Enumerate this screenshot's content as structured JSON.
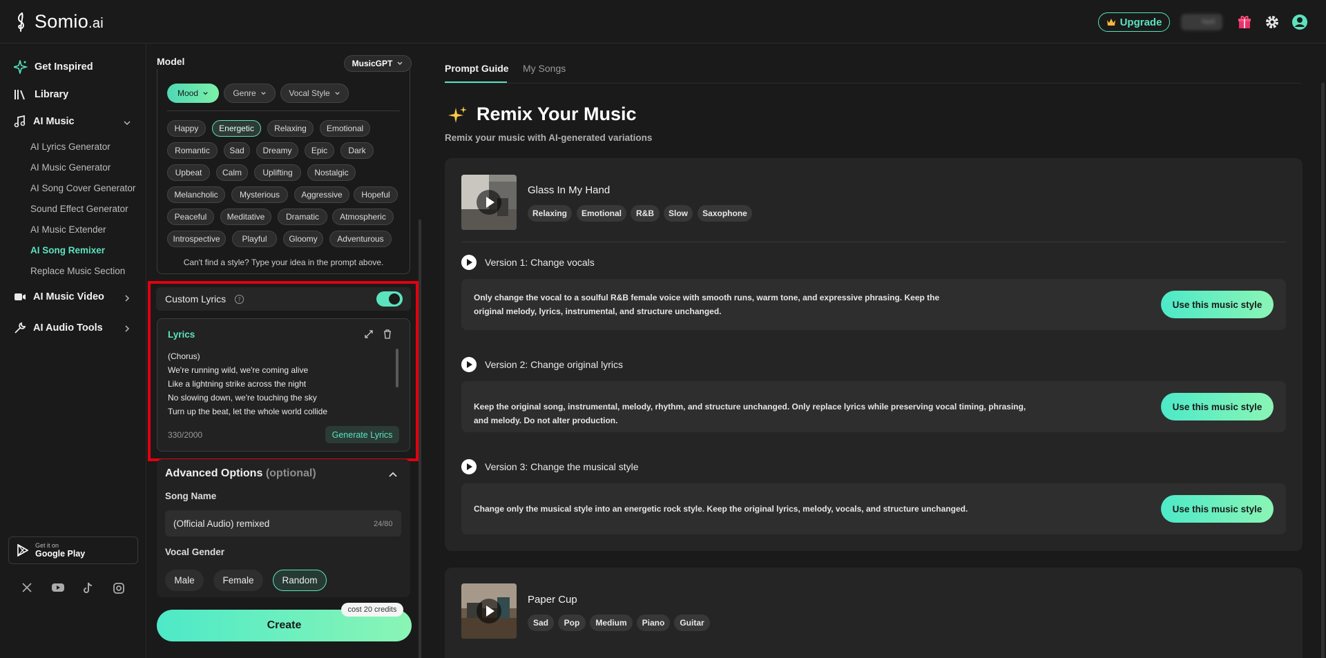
{
  "app": {
    "logo_text": "Somio",
    "logo_suffix": ".ai"
  },
  "header": {
    "upgrade_label": "Upgrade",
    "user_name": "Neil"
  },
  "sidebar": {
    "top_items": [
      {
        "label": "Get Inspired",
        "icon": "sparkle-icon"
      },
      {
        "label": "Library",
        "icon": "library-icon"
      },
      {
        "label": "AI Music",
        "icon": "music-note-icon"
      }
    ],
    "sub_items": [
      "AI Lyrics Generator",
      "AI Music Generator",
      "AI Song Cover Generator",
      "Sound Effect Generator",
      "AI Music Extender",
      "AI Song Remixer",
      "Replace Music Section"
    ],
    "active_sub": "AI Song Remixer",
    "bottom_items": [
      {
        "label": "AI Music Video",
        "icon": "video-icon"
      },
      {
        "label": "AI Audio Tools",
        "icon": "wrench-icon"
      }
    ],
    "google_play": {
      "small": "Get it on",
      "big": "Google Play"
    },
    "social": [
      "x-icon",
      "youtube-icon",
      "tiktok-icon",
      "instagram-icon"
    ]
  },
  "model": {
    "label": "Model",
    "value": "MusicGPT"
  },
  "filters": [
    {
      "label": "Mood",
      "active": true
    },
    {
      "label": "Genre",
      "active": false
    },
    {
      "label": "Vocal Style",
      "active": false
    }
  ],
  "mood_tags": [
    [
      "Happy",
      "Energetic",
      "Relaxing",
      "Emotional"
    ],
    [
      "Romantic",
      "Sad",
      "Dreamy",
      "Epic",
      "Dark"
    ],
    [
      "Upbeat",
      "Calm",
      "Uplifting",
      "Nostalgic"
    ],
    [
      "Melancholic",
      "Mysterious",
      "Aggressive",
      "Hopeful"
    ],
    [
      "Peaceful",
      "Meditative",
      "Dramatic",
      "Atmospheric"
    ],
    [
      "Introspective",
      "Playful",
      "Gloomy",
      "Adventurous"
    ]
  ],
  "selected_tag": "Energetic",
  "cant_find": "Can't find a style? Type your idea in the prompt above.",
  "custom_lyrics": {
    "label": "Custom Lyrics",
    "enabled": true,
    "lyrics_title": "Lyrics",
    "text": "(Chorus)\nWe're running wild, we're coming alive\nLike a lightning strike across the night\nNo slowing down, we're touching the sky\nTurn up the beat, let the whole world collide",
    "count": "330/2000",
    "generate_label": "Generate Lyrics"
  },
  "advanced": {
    "title": "Advanced Options",
    "optional": "(optional)",
    "song_name_label": "Song Name",
    "song_name_value": "(Official Audio) remixed",
    "song_name_count": "24/80",
    "vocal_gender_label": "Vocal Gender",
    "genders": [
      "Male",
      "Female",
      "Random"
    ],
    "selected_gender": "Random"
  },
  "create": {
    "label": "Create",
    "cost": "cost 20 credits"
  },
  "tabs": [
    {
      "label": "Prompt Guide",
      "active": true
    },
    {
      "label": "My Songs",
      "active": false
    }
  ],
  "guide": {
    "title": "Remix Your Music",
    "subtitle": "Remix your music with AI-generated variations"
  },
  "songs": [
    {
      "title": "Glass In My Hand",
      "tags": [
        "Relaxing",
        "Emotional",
        "R&B",
        "Slow",
        "Saxophone"
      ],
      "versions": [
        {
          "label": "Version 1: Change vocals",
          "text": "Only change the vocal to a soulful R&B female voice with smooth runs, warm tone, and expressive phrasing. Keep the original melody, lyrics, instrumental, and structure unchanged.",
          "button": "Use this music style"
        },
        {
          "label": "Version 2: Change original lyrics",
          "text": "Keep the original song, instrumental, melody, rhythm, and structure unchanged. Only replace lyrics while preserving vocal timing, phrasing, and melody. Do not alter production.",
          "button": "Use this music style"
        },
        {
          "label": "Version 3: Change the musical style",
          "text": "Change only the musical style into an energetic rock style. Keep the original lyrics, melody, vocals, and structure unchanged.",
          "button": "Use this music style"
        }
      ]
    },
    {
      "title": "Paper Cup",
      "tags": [
        "Sad",
        "Pop",
        "Medium",
        "Piano",
        "Guitar"
      ]
    }
  ],
  "colors": {
    "accent": "#5be3bf",
    "highlight": "#e3000f",
    "background": "#1a1a1a"
  }
}
